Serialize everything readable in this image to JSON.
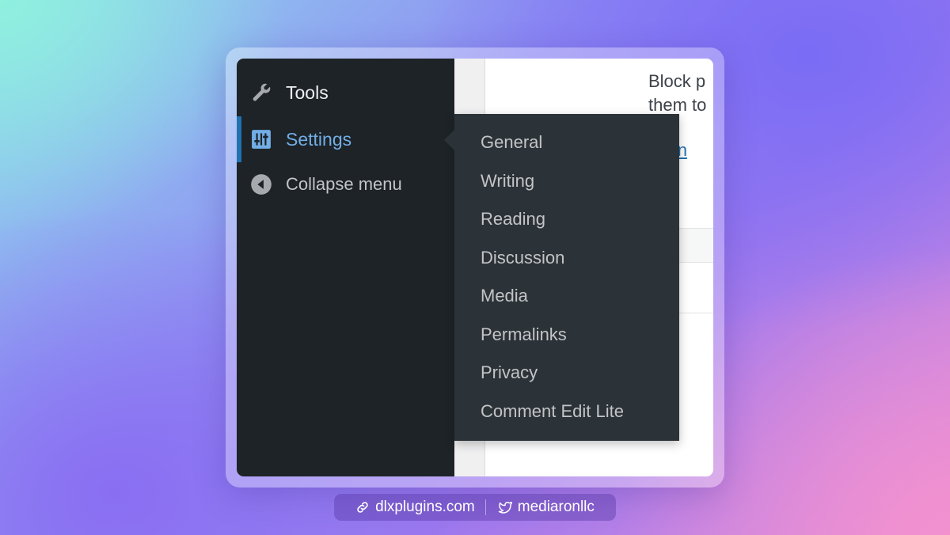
{
  "sidebar": {
    "items": [
      {
        "label": "Tools",
        "icon": "wrench-icon"
      },
      {
        "label": "Settings",
        "icon": "sliders-icon"
      },
      {
        "label": "Collapse menu",
        "icon": "collapse-arrow-icon"
      }
    ]
  },
  "submenu": {
    "items": [
      "General",
      "Writing",
      "Reading",
      "Discussion",
      "Media",
      "Permalinks",
      "Privacy",
      "Comment Edit Lite"
    ]
  },
  "content": {
    "text_line1": "Block p",
    "text_line2": "them to",
    "link_fragment": "d a n"
  },
  "footer": {
    "website": "dlxplugins.com",
    "twitter": "mediaronllc"
  },
  "colors": {
    "sidebar_bg": "#1d2327",
    "submenu_bg": "#2c3338",
    "active_text": "#72aee6",
    "active_indicator": "#2271b1"
  }
}
